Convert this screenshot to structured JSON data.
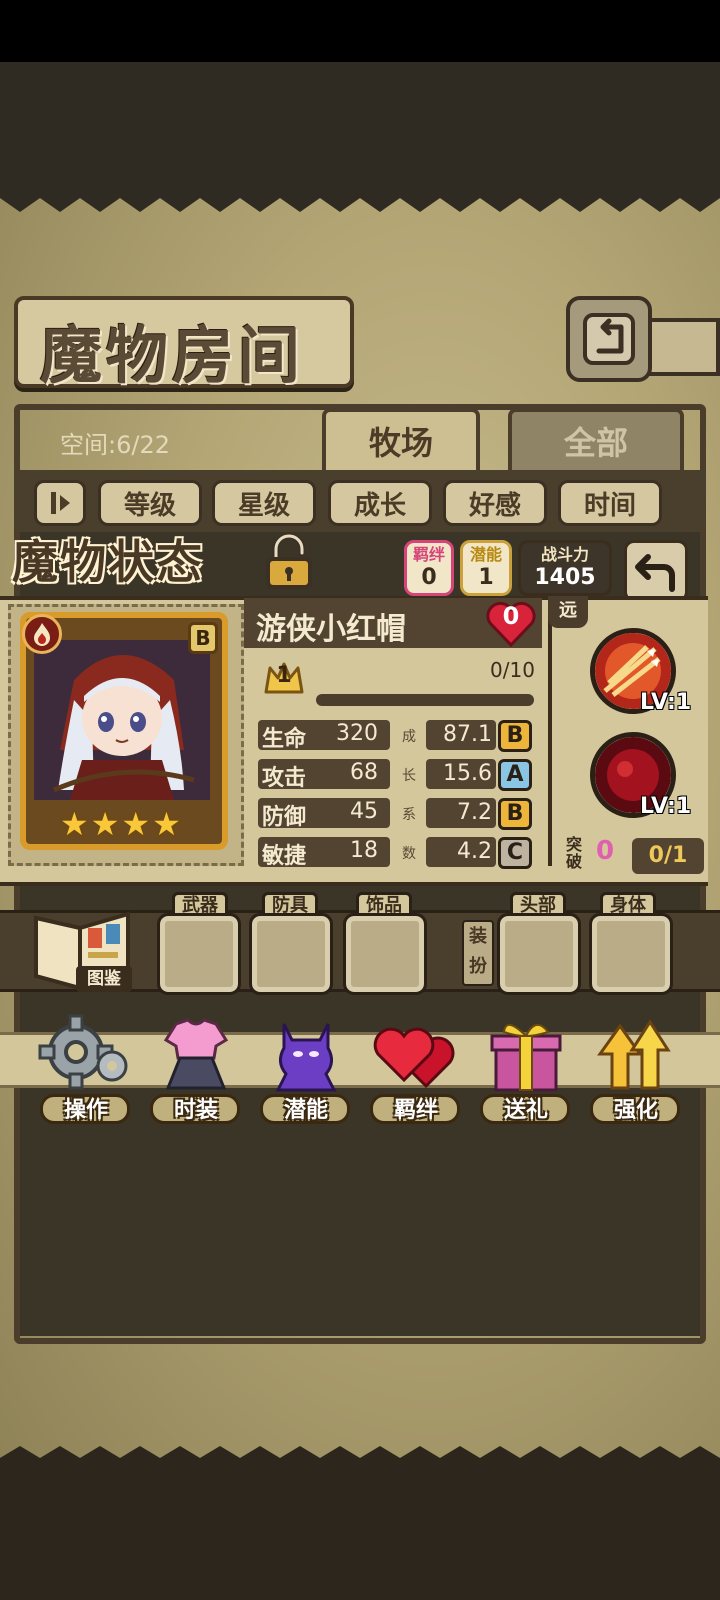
{
  "room": {
    "title": "魔物房间",
    "space_label": "空间:6/22",
    "tabs": [
      {
        "label": "牧场",
        "active": true
      },
      {
        "label": "全部",
        "active": false
      }
    ],
    "sort_buttons": [
      "等级",
      "星级",
      "成长",
      "好感",
      "时间"
    ],
    "sort_icon": "sort-toggle-icon"
  },
  "status": {
    "title": "魔物状态",
    "bond_label": "羁绊",
    "bond_value": "0",
    "potential_label": "潜能",
    "potential_value": "1",
    "power_label": "战斗力",
    "power_value": "1405"
  },
  "monster": {
    "name": "游侠小红帽",
    "rank": "B",
    "stars": 4,
    "affection": "0",
    "level": "1",
    "exp_text": "0/10",
    "exp_fraction": 0.0,
    "range_tag": "远",
    "stats": [
      {
        "name": "生命",
        "value": "320",
        "growth": "87.1",
        "grade": "B"
      },
      {
        "name": "攻击",
        "value": "68",
        "growth": "15.6",
        "grade": "A"
      },
      {
        "name": "防御",
        "value": "45",
        "growth": "7.2",
        "grade": "B"
      },
      {
        "name": "敏捷",
        "value": "18",
        "growth": "4.2",
        "grade": "C"
      }
    ],
    "growth_chars": [
      "成",
      "长",
      "系",
      "数"
    ],
    "skills": [
      {
        "level": "LV:1"
      },
      {
        "level": "LV:1"
      }
    ],
    "breakthrough_label": "突破",
    "breakthrough_count": "0",
    "breakthrough_progress": "0/1"
  },
  "equipment": {
    "codex_label": "图鉴",
    "slots": [
      "武器",
      "防具",
      "饰品",
      "头部",
      "身体"
    ],
    "dress_label": "装扮"
  },
  "actions": [
    {
      "label": "操作",
      "icon": "gear-icon"
    },
    {
      "label": "时装",
      "icon": "outfit-icon"
    },
    {
      "label": "潜能",
      "icon": "demon-icon"
    },
    {
      "label": "羁绊",
      "icon": "hearts-icon"
    },
    {
      "label": "送礼",
      "icon": "gift-icon"
    },
    {
      "label": "强化",
      "icon": "upgrade-arrows-icon"
    }
  ],
  "colors": {
    "panel": "#d4c79b",
    "dark": "#534431",
    "gold": "#e9b23a",
    "bond_pink": "#d6457a"
  }
}
